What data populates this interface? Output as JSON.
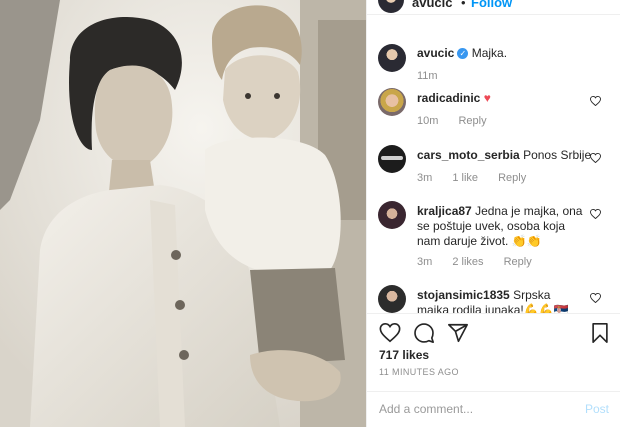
{
  "header": {
    "username": "avucic",
    "separator": "•",
    "follow_label": "Follow"
  },
  "caption": {
    "username": "avucic",
    "text": "Majka.",
    "time": "11m"
  },
  "comments": [
    {
      "username": "radicadinic",
      "text": "♥",
      "time": "10m",
      "likes": "",
      "reply_label": "Reply"
    },
    {
      "username": "cars_moto_serbia",
      "text": "Ponos Srbije",
      "time": "3m",
      "likes": "1 like",
      "reply_label": "Reply"
    },
    {
      "username": "kraljica87",
      "text": "Jedna je majka, ona se poštuje uvek, osoba koja nam daruje život. 👏👏",
      "time": "3m",
      "likes": "2 likes",
      "reply_label": "Reply"
    },
    {
      "username": "stojansimic1835",
      "text": "Srpska majka rodila iunaka!💪💪🇷🇸",
      "time": "",
      "likes": "",
      "reply_label": ""
    }
  ],
  "post": {
    "likes": "717 likes",
    "time_ago": "11 MINUTES AGO"
  },
  "add_comment": {
    "placeholder": "Add a comment...",
    "post_label": "Post"
  },
  "icons": [
    "heart-icon",
    "comment-icon",
    "share-icon",
    "bookmark-icon",
    "verified-icon"
  ],
  "colors": {
    "link_blue": "#0095f6",
    "verified_blue": "#3897f0",
    "heart_red": "#ed4956",
    "muted_text": "#8e8e8e",
    "post_disabled": "#b2dffc"
  }
}
